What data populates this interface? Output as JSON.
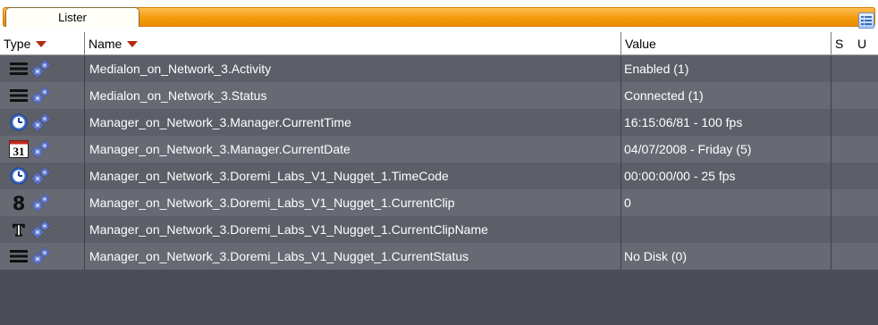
{
  "tab": {
    "label": "Lister"
  },
  "columns": {
    "type": "Type",
    "name": "Name",
    "value": "Value",
    "s": "S",
    "u": "U"
  },
  "rows": [
    {
      "icon": "list-icon",
      "name": "Medialon_on_Network_3.Activity",
      "value": "Enabled (1)"
    },
    {
      "icon": "list-icon",
      "name": "Medialon_on_Network_3.Status",
      "value": "Connected (1)"
    },
    {
      "icon": "clock-icon",
      "name": "Manager_on_Network_3.Manager.CurrentTime",
      "value": "16:15:06/81 - 100 fps"
    },
    {
      "icon": "calendar-icon",
      "name": "Manager_on_Network_3.Manager.CurrentDate",
      "value": "04/07/2008 - Friday (5)"
    },
    {
      "icon": "clock-icon",
      "name": "Manager_on_Network_3.Doremi_Labs_V1_Nugget_1.TimeCode",
      "value": "00:00:00/00 - 25 fps"
    },
    {
      "icon": "number-icon",
      "name": "Manager_on_Network_3.Doremi_Labs_V1_Nugget_1.CurrentClip",
      "value": "0"
    },
    {
      "icon": "text-icon",
      "name": "Manager_on_Network_3.Doremi_Labs_V1_Nugget_1.CurrentClipName",
      "value": ""
    },
    {
      "icon": "list-icon",
      "name": "Manager_on_Network_3.Doremi_Labs_V1_Nugget_1.CurrentStatus",
      "value": "No Disk (0)"
    }
  ],
  "calendar_icon_text": "31",
  "number_icon_text": "8",
  "text_icon_text": "T"
}
